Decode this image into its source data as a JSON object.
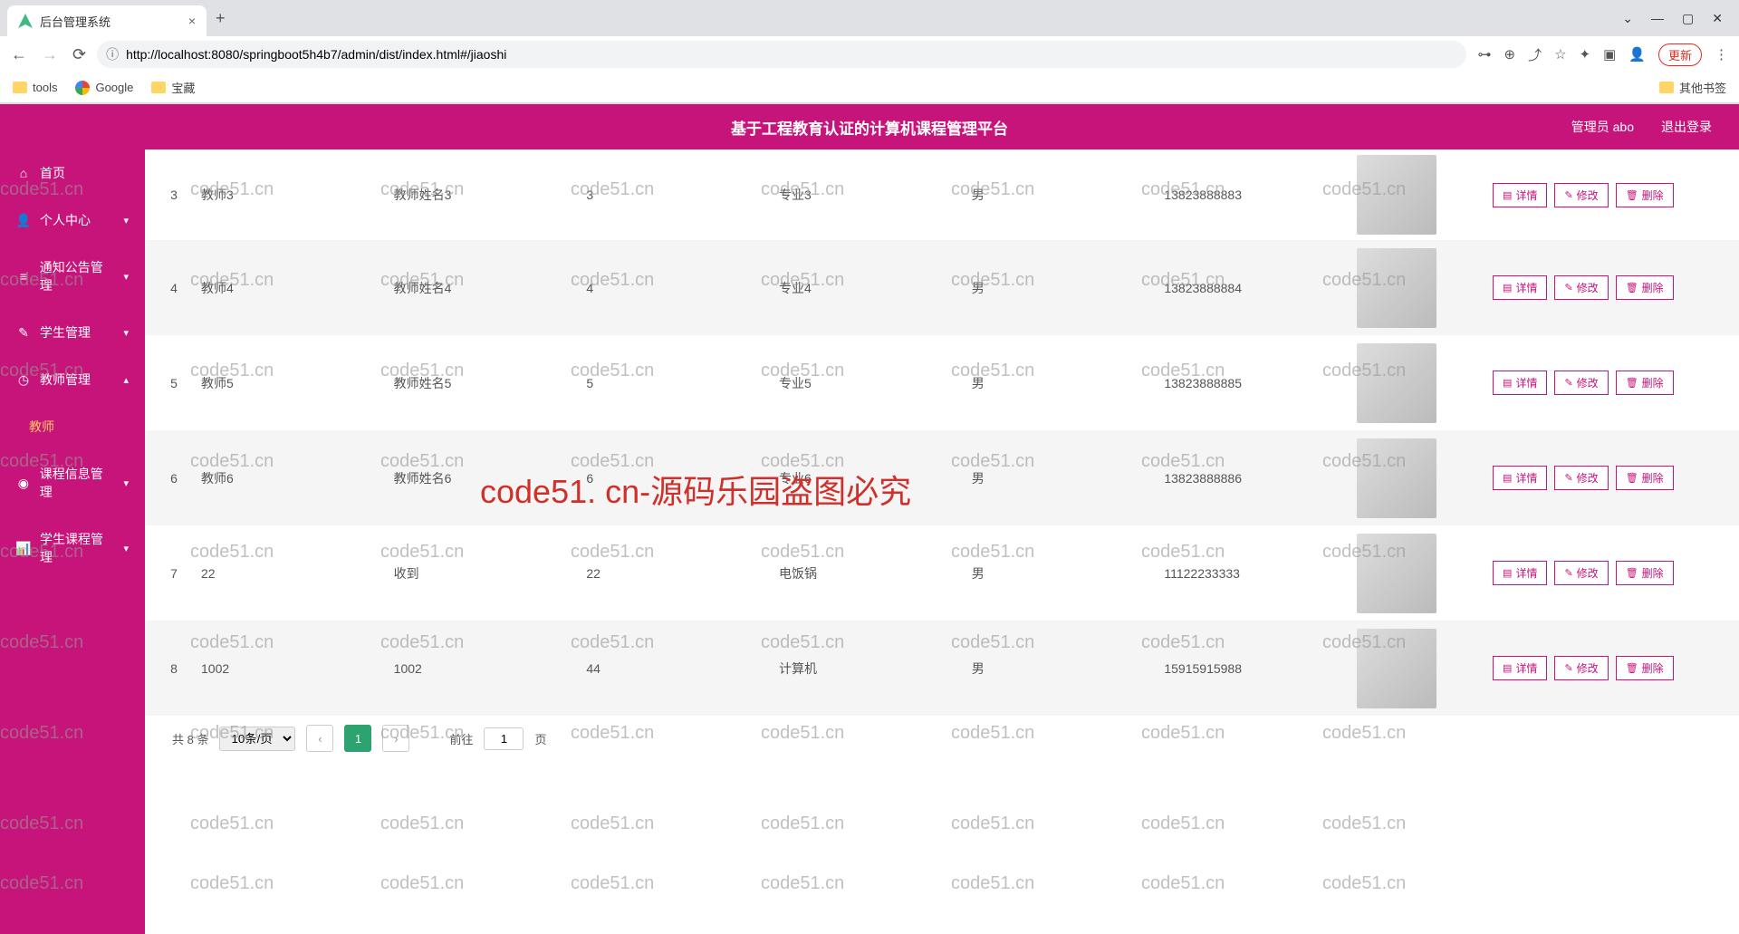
{
  "browser": {
    "tab_title": "后台管理系统",
    "url": "http://localhost:8080/springboot5h4b7/admin/dist/index.html#/jiaoshi",
    "update_label": "更新",
    "bookmarks": [
      "tools",
      "Google",
      "宝藏"
    ],
    "other_bookmarks": "其他书签"
  },
  "header": {
    "title": "基于工程教育认证的计算机课程管理平台",
    "user_label": "管理员 abo",
    "logout": "退出登录"
  },
  "sidebar": [
    {
      "icon": "home",
      "label": "首页",
      "arrow": ""
    },
    {
      "icon": "user",
      "label": "个人中心",
      "arrow": "▾"
    },
    {
      "icon": "list",
      "label": "通知公告管理",
      "arrow": "▾"
    },
    {
      "icon": "student",
      "label": "学生管理",
      "arrow": "▾"
    },
    {
      "icon": "clock",
      "label": "教师管理",
      "arrow": "▴"
    },
    {
      "icon": "",
      "label": "教师",
      "arrow": "",
      "sub": true
    },
    {
      "icon": "bulb",
      "label": "课程信息管理",
      "arrow": "▾"
    },
    {
      "icon": "chart",
      "label": "学生课程管理",
      "arrow": "▾"
    }
  ],
  "rows": [
    {
      "idx": "3",
      "c1": "教师3",
      "c2": "教师姓名3",
      "c3": "3",
      "c4": "专业3",
      "c5": "男",
      "c6": "13823888883"
    },
    {
      "idx": "4",
      "c1": "教师4",
      "c2": "教师姓名4",
      "c3": "4",
      "c4": "专业4",
      "c5": "男",
      "c6": "13823888884"
    },
    {
      "idx": "5",
      "c1": "教师5",
      "c2": "教师姓名5",
      "c3": "5",
      "c4": "专业5",
      "c5": "男",
      "c6": "13823888885"
    },
    {
      "idx": "6",
      "c1": "教师6",
      "c2": "教师姓名6",
      "c3": "6",
      "c4": "专业6",
      "c5": "男",
      "c6": "13823888886"
    },
    {
      "idx": "7",
      "c1": "22",
      "c2": "收到",
      "c3": "22",
      "c4": "电饭锅",
      "c5": "男",
      "c6": "11122233333"
    },
    {
      "idx": "8",
      "c1": "1002",
      "c2": "1002",
      "c3": "44",
      "c4": "计算机",
      "c5": "男",
      "c6": "15915915988"
    }
  ],
  "actions": {
    "detail": "详情",
    "edit": "修改",
    "delete": "删除"
  },
  "pager": {
    "total_text": "共 8 条",
    "page_size": "10条/页",
    "current": "1",
    "goto_prefix": "前往",
    "goto_value": "1",
    "goto_suffix": "页"
  },
  "watermark": "code51.cn",
  "watermark_big": "code51. cn-源码乐园盗图必究",
  "icon_map": {
    "home": "⌂",
    "user": "👤",
    "list": "≡",
    "student": "✎",
    "clock": "◷",
    "bulb": "◉",
    "chart": "📊"
  }
}
